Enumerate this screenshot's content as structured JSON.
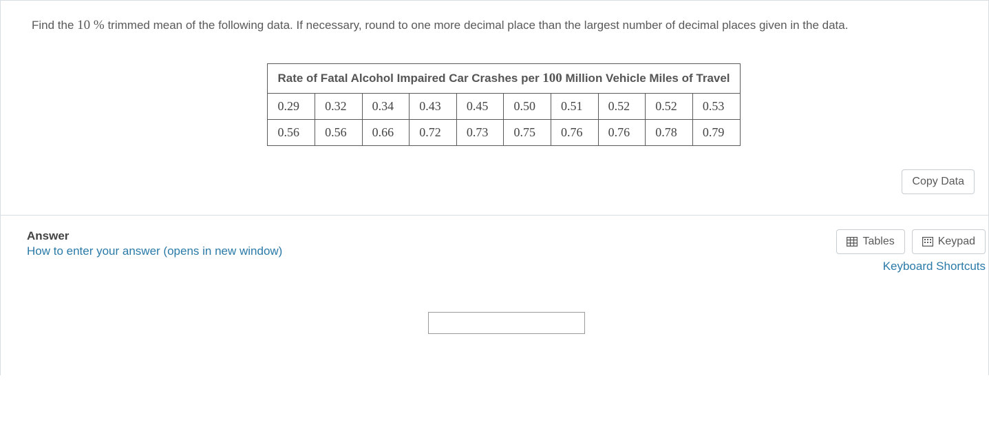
{
  "question": {
    "prefix": "Find the ",
    "percent": "10 %",
    "mid": " trimmed mean of the following data. If necessary, round to one more decimal place than the largest number of decimal places given in the data."
  },
  "table": {
    "title_a": "Rate of Fatal Alcohol Impaired Car Crashes per ",
    "title_num": "100",
    "title_b": " Million Vehicle Miles of Travel",
    "rows": [
      [
        "0.29",
        "0.32",
        "0.34",
        "0.43",
        "0.45",
        "0.50",
        "0.51",
        "0.52",
        "0.52",
        "0.53"
      ],
      [
        "0.56",
        "0.56",
        "0.66",
        "0.72",
        "0.73",
        "0.75",
        "0.76",
        "0.76",
        "0.78",
        "0.79"
      ]
    ]
  },
  "buttons": {
    "copy_data": "Copy Data",
    "tables": "Tables",
    "keypad": "Keypad"
  },
  "answer": {
    "title": "Answer",
    "help_link": "How to enter your answer (opens in new window)",
    "shortcuts": "Keyboard Shortcuts",
    "value": ""
  },
  "chart_data": {
    "type": "table",
    "title": "Rate of Fatal Alcohol Impaired Car Crashes per 100 Million Vehicle Miles of Travel",
    "values": [
      0.29,
      0.32,
      0.34,
      0.43,
      0.45,
      0.5,
      0.51,
      0.52,
      0.52,
      0.53,
      0.56,
      0.56,
      0.66,
      0.72,
      0.73,
      0.75,
      0.76,
      0.76,
      0.78,
      0.79
    ]
  }
}
